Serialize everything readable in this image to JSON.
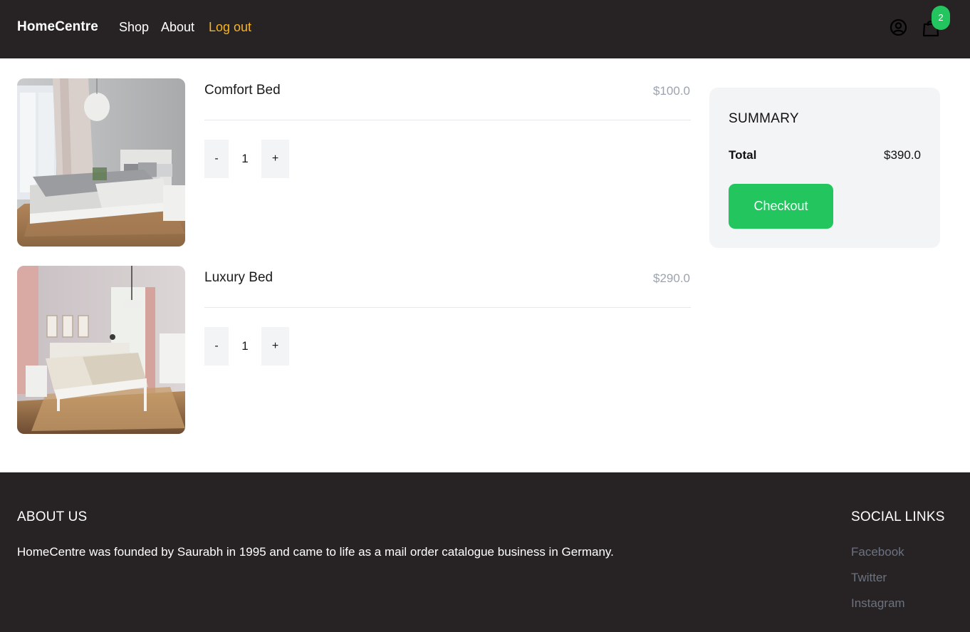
{
  "header": {
    "brand": "HomeCentre",
    "nav": {
      "shop": "Shop",
      "about": "About",
      "logout": "Log out"
    },
    "cart_count": "2",
    "icons": {
      "account": "user-circle-icon",
      "cart": "shopping-bag-icon"
    },
    "colors": {
      "background": "#272324",
      "logout": "#f5b325",
      "badge": "#22c55e"
    }
  },
  "cart": {
    "items": [
      {
        "name": "Comfort Bed",
        "price": "$100.0",
        "quantity": "1",
        "minus_label": "-",
        "plus_label": "+"
      },
      {
        "name": "Luxury Bed",
        "price": "$290.0",
        "quantity": "1",
        "minus_label": "-",
        "plus_label": "+"
      }
    ]
  },
  "summary": {
    "title": "SUMMARY",
    "total_label": "Total",
    "total_value": "$390.0",
    "checkout_label": "Checkout",
    "accent": "#22c55e"
  },
  "footer": {
    "about_title": "ABOUT US",
    "about_text": "HomeCentre was founded by Saurabh in 1995 and came to life as a mail order catalogue business in Germany.",
    "social_title": "SOCIAL LINKS",
    "social_links": [
      "Facebook",
      "Twitter",
      "Instagram"
    ]
  }
}
